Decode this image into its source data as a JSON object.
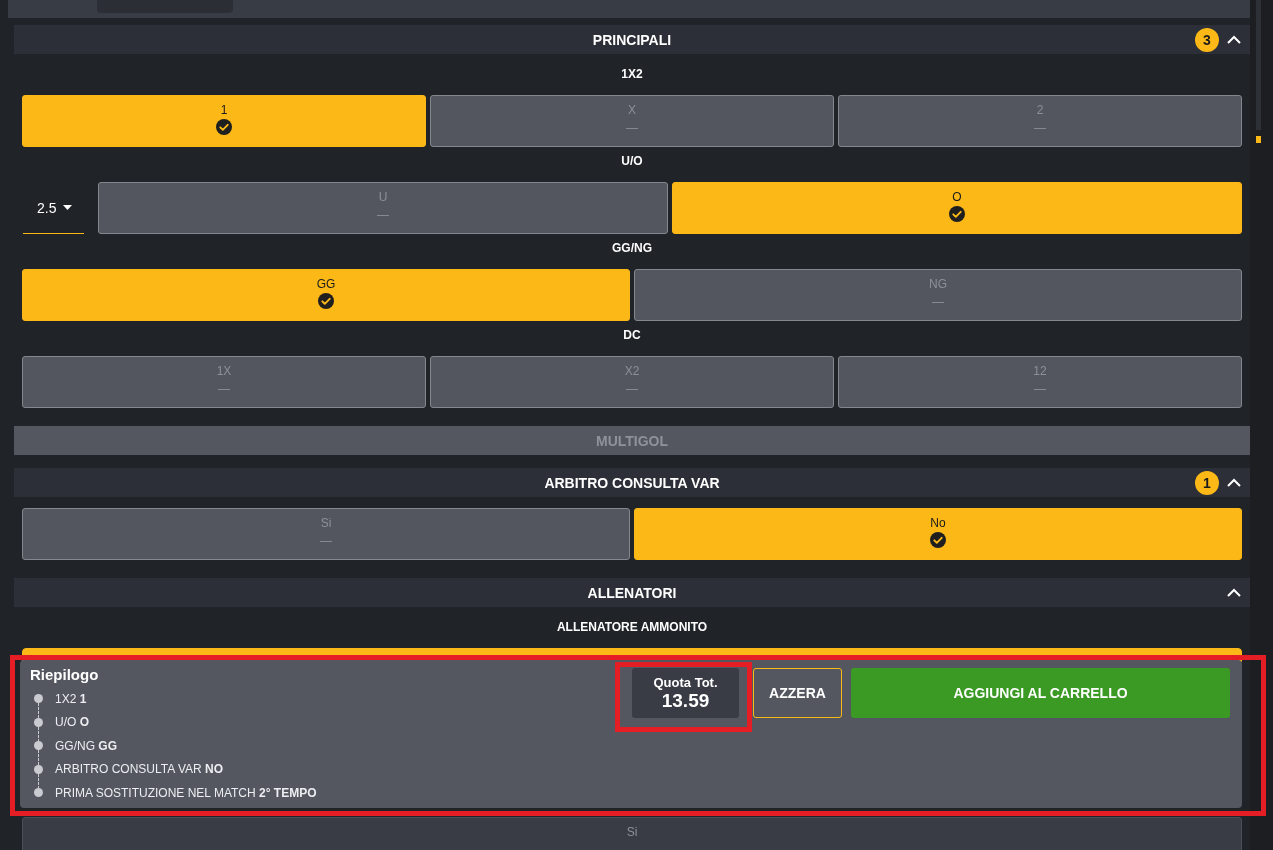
{
  "sections": [
    {
      "title": "PRINCIPALI",
      "badge": "3",
      "expanded": true,
      "disabled": false,
      "markets": [
        {
          "title": "1X2",
          "options": [
            {
              "label": "1",
              "selected": true
            },
            {
              "label": "X",
              "selected": false,
              "odds": "—"
            },
            {
              "label": "2",
              "selected": false,
              "odds": "—"
            }
          ]
        },
        {
          "title": "U/O",
          "line": {
            "value": "2.5"
          },
          "options": [
            {
              "label": "U",
              "selected": false,
              "odds": "—"
            },
            {
              "label": "O",
              "selected": true
            }
          ]
        },
        {
          "title": "GG/NG",
          "options": [
            {
              "label": "GG",
              "selected": true
            },
            {
              "label": "NG",
              "selected": false,
              "odds": "—"
            }
          ]
        },
        {
          "title": "DC",
          "options": [
            {
              "label": "1X",
              "selected": false,
              "odds": "—"
            },
            {
              "label": "X2",
              "selected": false,
              "odds": "—"
            },
            {
              "label": "12",
              "selected": false,
              "odds": "—"
            }
          ]
        }
      ]
    },
    {
      "title": "MULTIGOL",
      "disabled": true
    },
    {
      "title": "ARBITRO CONSULTA VAR",
      "badge": "1",
      "expanded": true,
      "disabled": false,
      "markets": [
        {
          "options": [
            {
              "label": "Si",
              "selected": false,
              "odds": "—"
            },
            {
              "label": "No",
              "selected": true
            }
          ]
        }
      ]
    },
    {
      "title": "ALLENATORI",
      "expanded": true,
      "disabled": false,
      "markets": [
        {
          "title": "ALLENATORE AMMONITO",
          "options": [
            {
              "selected": true,
              "covered": true
            }
          ]
        },
        {
          "options": [
            {
              "label": "Si",
              "selected": false,
              "disabled": true
            }
          ]
        }
      ]
    }
  ],
  "summary": {
    "title": "Riepilogo",
    "highlighted": true,
    "items": [
      "1X2 **1**",
      "U/O **O**",
      "GG/NG **GG**",
      "ARBITRO CONSULTA VAR **NO**",
      "PRIMA SOSTITUZIONE NEL MATCH **2° TEMPO**"
    ],
    "total": {
      "label": "Quota Tot.",
      "value": "13.59",
      "highlighted": true
    },
    "buttons": [
      {
        "label": "AZZERA",
        "kind": "reset"
      },
      {
        "label": "AGGIUNGI AL CARRELLO",
        "kind": "primary"
      }
    ]
  }
}
